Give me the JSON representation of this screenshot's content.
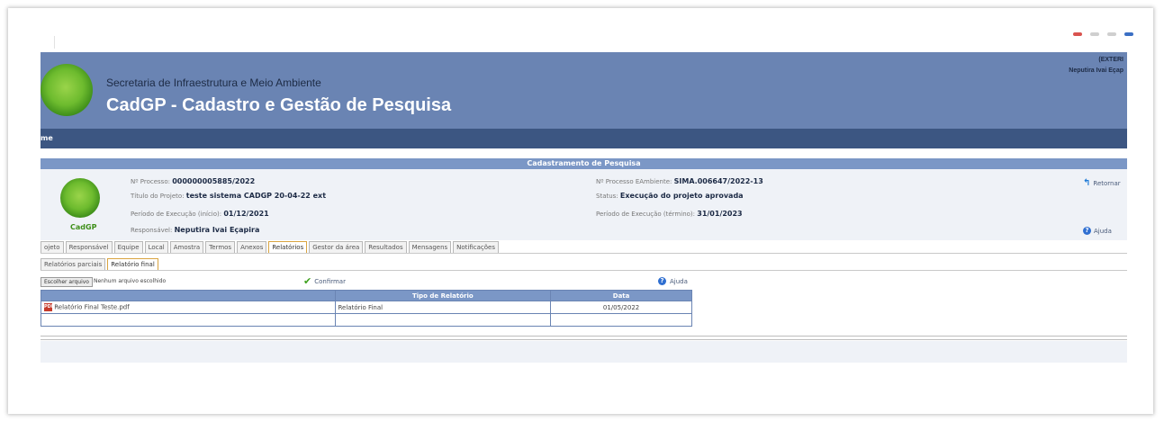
{
  "header": {
    "org": "Secretaria de Infraestrutura e Meio Ambiente",
    "title": "CadGP - Cadastro e Gestão de Pesquisa",
    "external_tag": "(EXTERI",
    "user": "Neputira Ivai Eçap"
  },
  "nav": {
    "home": "me"
  },
  "section": {
    "title": "Cadastramento de Pesquisa"
  },
  "project": {
    "logo_label": "CadGP",
    "processo_label": "Nº Processo:",
    "processo_value": "000000005885/2022",
    "titulo_label": "Título do Projeto:",
    "titulo_value": "teste sistema CADGP 20-04-22 ext",
    "inicio_label": "Período de Execução (início):",
    "inicio_value": "01/12/2021",
    "responsavel_label": "Responsável:",
    "responsavel_value": "Neputira Ivai Eçapira",
    "eambiente_label": "Nº Processo EAmbiente:",
    "eambiente_value": "SIMA.006647/2022-13",
    "status_label": "Status:",
    "status_value": "Execução do projeto aprovada",
    "termino_label": "Período de Execução (término):",
    "termino_value": "31/01/2023"
  },
  "actions": {
    "retornar": "Retornar",
    "ajuda": "Ajuda"
  },
  "tabs": [
    {
      "label": "ojeto"
    },
    {
      "label": "Responsável"
    },
    {
      "label": "Equipe"
    },
    {
      "label": "Local"
    },
    {
      "label": "Amostra"
    },
    {
      "label": "Termos"
    },
    {
      "label": "Anexos"
    },
    {
      "label": "Relatórios"
    },
    {
      "label": "Gestor da área"
    },
    {
      "label": "Resultados"
    },
    {
      "label": "Mensagens"
    },
    {
      "label": "Notificações"
    }
  ],
  "subtabs": [
    {
      "label": "Relatórios parciais"
    },
    {
      "label": "Relatório final"
    }
  ],
  "upload": {
    "button": "Escolher arquivo",
    "note": "Nenhum arquivo escolhido",
    "confirm": "Confirmar",
    "help": "Ajuda"
  },
  "table": {
    "headers": [
      "",
      "Tipo de Relatório",
      "Data"
    ],
    "rows": [
      {
        "file": "Relatório Final Teste.pdf",
        "tipo": "Relatório Final",
        "data": "01/05/2022"
      },
      {
        "file": "",
        "tipo": "",
        "data": ""
      }
    ]
  },
  "colors": {
    "banner": "#6a84b3",
    "navbar": "#3c5682",
    "section": "#7b97c6",
    "active_tab_border": "#d9a441"
  }
}
